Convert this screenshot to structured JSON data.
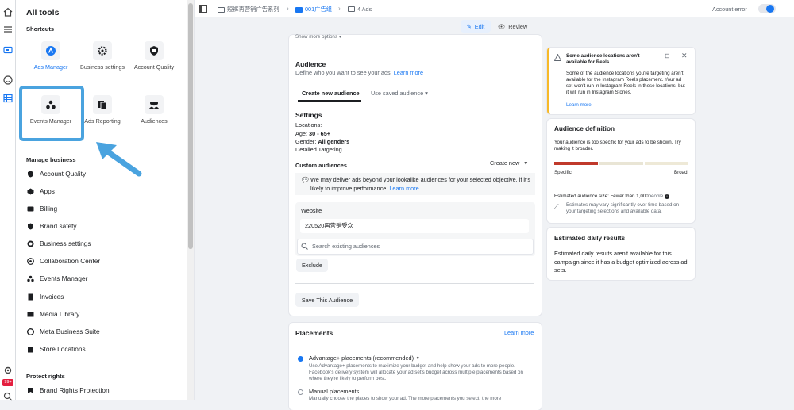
{
  "tools_panel": {
    "title": "All tools",
    "shortcuts_heading": "Shortcuts",
    "shortcuts": [
      {
        "label": "Ads Manager",
        "icon": "ads-manager-icon"
      },
      {
        "label": "Business settings",
        "icon": "gear-icon"
      },
      {
        "label": "Account Quality",
        "icon": "shield-icon"
      },
      {
        "label": "Events Manager",
        "icon": "events-manager-icon"
      },
      {
        "label": "Ads Reporting",
        "icon": "reporting-icon"
      },
      {
        "label": "Audiences",
        "icon": "audiences-icon"
      }
    ],
    "manage_heading": "Manage business",
    "manage_items": [
      "Account Quality",
      "Apps",
      "Billing",
      "Brand safety",
      "Business settings",
      "Collaboration Center",
      "Events Manager",
      "Invoices",
      "Media Library",
      "Meta Business Suite",
      "Store Locations"
    ],
    "protect_heading": "Protect rights",
    "protect_items": [
      "Brand Rights Protection"
    ]
  },
  "topbar": {
    "crumb1": "短裤再营销广告系列",
    "crumb2": "001广告组",
    "crumb3": "4 Ads",
    "account": "Account error"
  },
  "actions": {
    "edit": "Edit",
    "review": "Review"
  },
  "audience": {
    "show_more": "Show more options",
    "title": "Audience",
    "subtitle": "Define who you want to see your ads.",
    "learn_more": "Learn more",
    "tab_create": "Create new audience",
    "tab_saved": "Use saved audience",
    "settings_title": "Settings",
    "locations_label": "Locations:",
    "age_label": "Age:",
    "age_value": "30 - 65+",
    "gender_label": "Gender:",
    "gender_value": "All genders",
    "detailed_targeting": "Detailed Targeting",
    "custom_audiences": "Custom audiences",
    "create_new": "Create new",
    "notice": "We may deliver ads beyond your lookalike audiences for your selected objective, if it's likely to improve performance.",
    "notice_link": "Learn more",
    "website_label": "Website",
    "website_value": "220520再营销受众",
    "search_placeholder": "Search existing audiences",
    "exclude": "Exclude",
    "save_audience": "Save This Audience"
  },
  "placements": {
    "title": "Placements",
    "learn_more": "Learn more",
    "advantage_title": "Advantage+ placements (recommended)",
    "advantage_desc": "Use Advantage+ placements to maximize your budget and help show your ads to more people. Facebook's delivery system will allocate your ad set's budget across multiple placements based on where they're likely to perform best.",
    "manual_title": "Manual placements",
    "manual_desc": "Manually choose the places to show your ad. The more placements you select, the more"
  },
  "warning": {
    "title": "Some audience locations aren't available for Reels",
    "body": "Some of the audience locations you're targeting aren't available for the Instagram Reels placement. Your ad set won't run in Instagram Reels in these locations, but it will run in Instagram Stories.",
    "link": "Learn more"
  },
  "definition": {
    "title": "Audience definition",
    "body": "Your audience is too specific for your ads to be shown. Try making it broader.",
    "specific": "Specific",
    "broad": "Broad",
    "size_label": "Estimated audience size: Fewer than 1,000",
    "size_unit": "people",
    "note": "Estimates may vary significantly over time based on your targeting selections and available data."
  },
  "estimated": {
    "title": "Estimated daily results",
    "body": "Estimated daily results aren't available for this campaign since it has a budget optimized across ad sets."
  },
  "rail_badge": "99+",
  "colors": {
    "accent": "#1877f2",
    "highlight": "#4aa3df",
    "warning": "#f7b928",
    "meter_specific": "#c0392b"
  }
}
